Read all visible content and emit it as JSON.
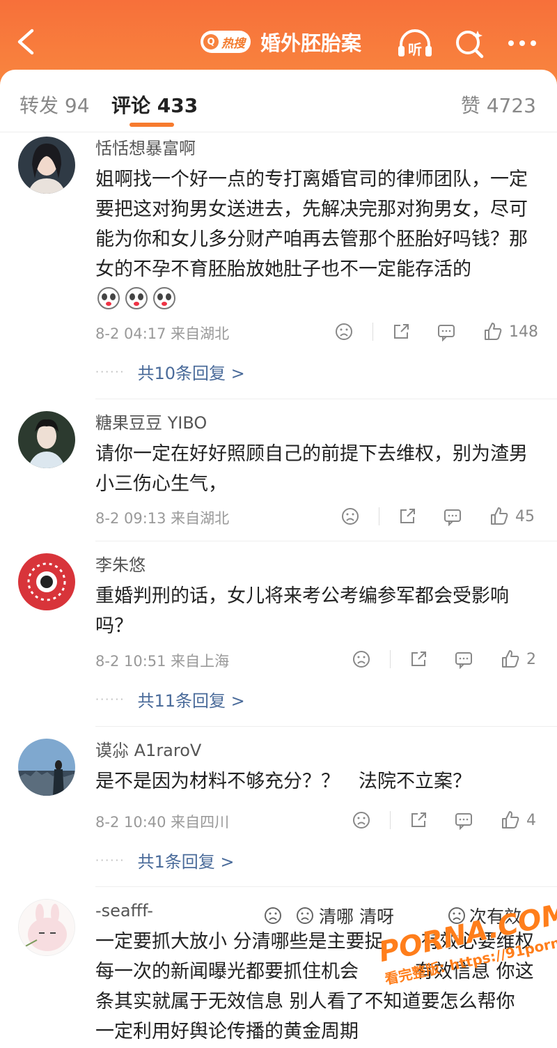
{
  "header": {
    "back_icon": "chevron-left-icon",
    "hot_badge_mark": "Q",
    "hot_badge": "热搜",
    "title": "婚外胚胎案",
    "listen_label": "听",
    "colors": {
      "bar": "#f7703a",
      "accent": "#f77b2e",
      "link": "#4a6b9a"
    }
  },
  "tabs": {
    "repost": "转发 94",
    "comments": "评论 433",
    "likes": "赞 4723"
  },
  "comments": [
    {
      "user": "恬恬想暴富啊",
      "text": "姐啊找一个好一点的专打离婚官司的律师团队，一定要把这对狗男女送进去，先解决完那对狗男女，尽可能为你和女儿多分财产咱再去管那个胚胎好吗钱？那女的不孕不育胚胎放她肚子也不一定能存活的",
      "emoji": [
        "sad-panda-icon",
        "sad-panda-icon",
        "sad-panda-icon"
      ],
      "time": "8-2 04:17 来自湖北",
      "likes": "148",
      "replies": "共10条回复 >"
    },
    {
      "user": "糖果豆豆 YIBO",
      "text": "请你一定在好好照顾自己的前提下去维权，别为渣男小三伤心生气，",
      "time": "8-2 09:13 来自湖北",
      "likes": "45"
    },
    {
      "user": "李朱悠",
      "text": "重婚判刑的话，女儿将来考公考编参军都会受影响吗？",
      "time": "8-2 10:51 来自上海",
      "likes": "2",
      "replies": "共11条回复 >"
    },
    {
      "user": "谟尛 A1raroV",
      "text": "是不是因为材料不够充分？？　法院不立案？",
      "time": "8-2 10:40 来自四川",
      "likes": "4",
      "replies": "共1条回复 >"
    },
    {
      "user": "-seafff-",
      "text": "一定要抓大放小 分清哪些是主要捉　　有效必要维权 每一次的新闻曝光都要抓住机会　　　有效信息 你这条其实就属于无效信息 别人看了不知道要怎么帮你 一定利用好舆论传播的黄金周期"
    }
  ],
  "overlay_fragments": [
    "清哪 清呀",
    "次有效"
  ],
  "watermark": {
    "big": "PORNA.COM",
    "small": "看完整版: https://91porna77.com"
  }
}
